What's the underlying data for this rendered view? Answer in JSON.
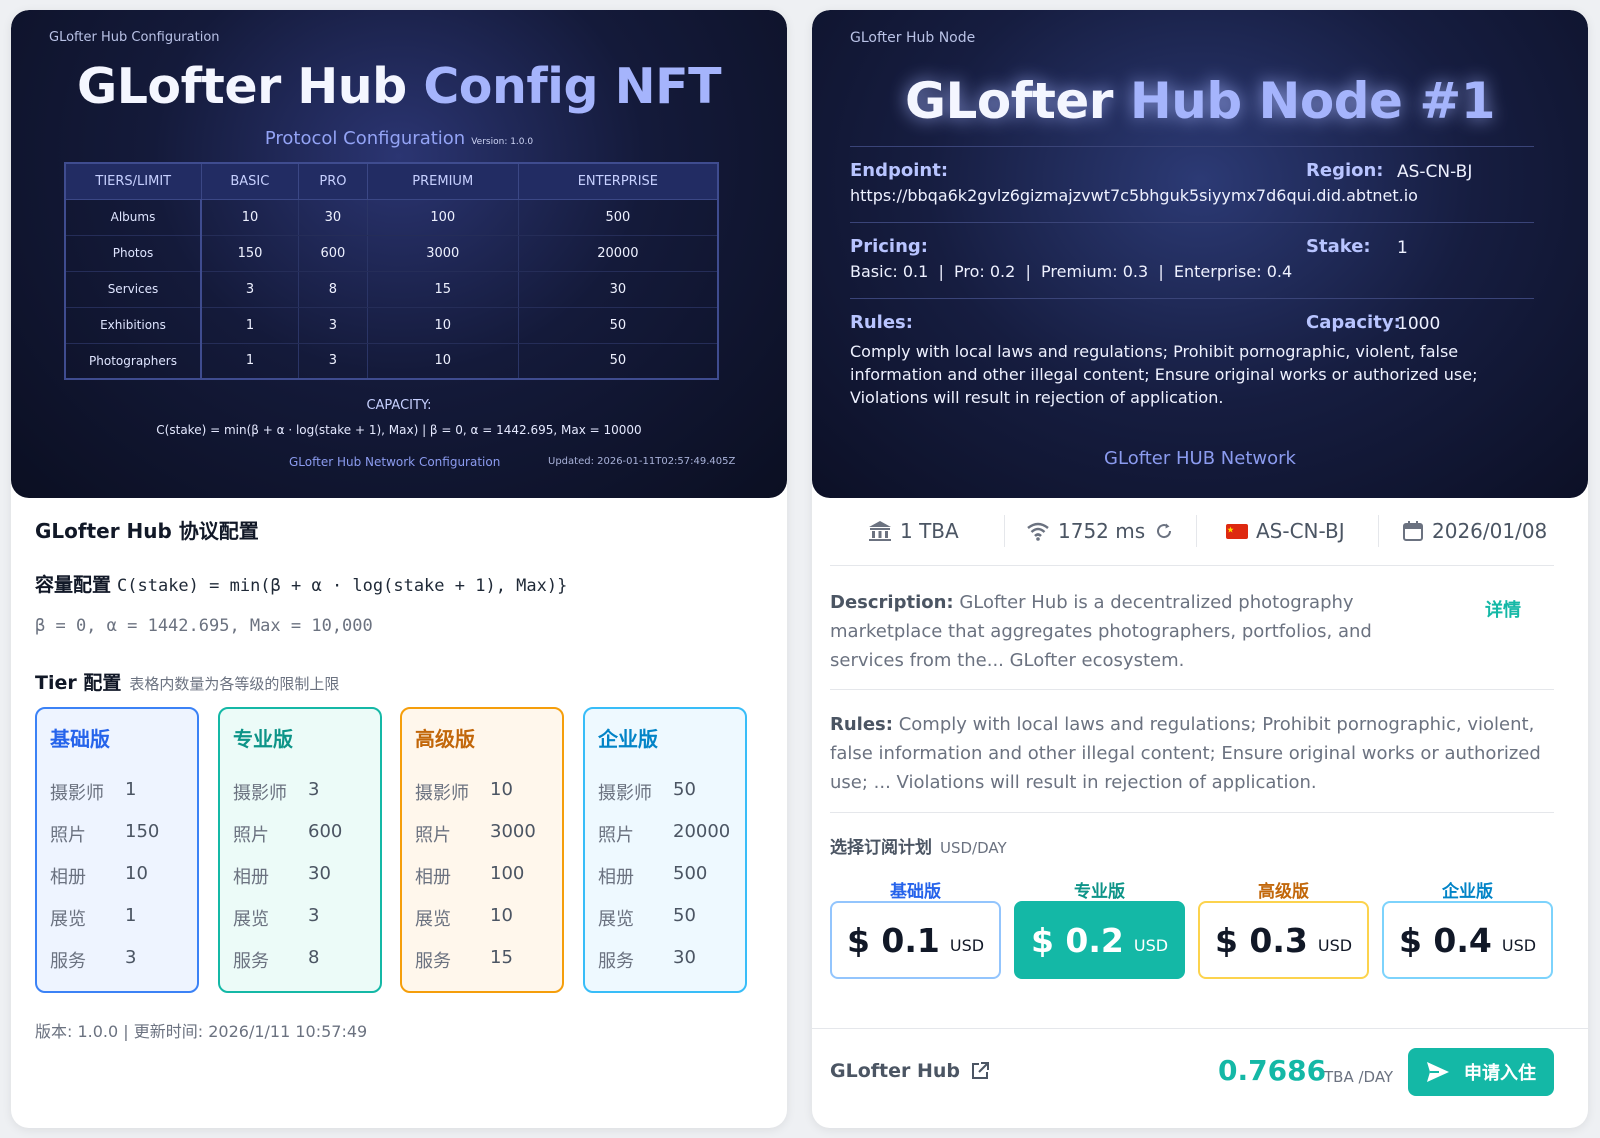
{
  "left": {
    "nft": {
      "small_label": "GLofter Hub Configuration",
      "title_part1": "GLofter Hub",
      "title_part2": "Config NFT",
      "subtitle": "Protocol Configuration",
      "version_label": "Version: 1.0.0",
      "table": {
        "headers": [
          "TIERS/LIMIT",
          "BASIC",
          "PRO",
          "PREMIUM",
          "ENTERPRISE"
        ],
        "rows": [
          [
            "Albums",
            "10",
            "30",
            "100",
            "500"
          ],
          [
            "Photos",
            "150",
            "600",
            "3000",
            "20000"
          ],
          [
            "Services",
            "3",
            "8",
            "15",
            "30"
          ],
          [
            "Exhibitions",
            "1",
            "3",
            "10",
            "50"
          ],
          [
            "Photographers",
            "1",
            "3",
            "10",
            "50"
          ]
        ]
      },
      "capacity_label": "CAPACITY:",
      "capacity_formula": "C(stake) = min(β + α · log(stake + 1), Max) | β = 0, α = 1442.695, Max = 10000",
      "footer_left": "GLofter Hub Network Configuration",
      "footer_right": "Updated: 2026-01-11T02:57:49.405Z"
    },
    "heading": "GLofter Hub 协议配置",
    "capacity_title": "容量配置",
    "capacity_formula": "C(stake) = min(β + α · log(stake + 1), Max)}",
    "capacity_params": "β = 0, α = 1442.695, Max = 10,000",
    "tier_title": "Tier 配置",
    "tier_note": "表格内数量为各等级的限制上限",
    "tiers": [
      {
        "name": "基础版",
        "rows": [
          [
            "摄影师",
            "1"
          ],
          [
            "照片",
            "150"
          ],
          [
            "相册",
            "10"
          ],
          [
            "展览",
            "1"
          ],
          [
            "服务",
            "3"
          ]
        ]
      },
      {
        "name": "专业版",
        "rows": [
          [
            "摄影师",
            "3"
          ],
          [
            "照片",
            "600"
          ],
          [
            "相册",
            "30"
          ],
          [
            "展览",
            "3"
          ],
          [
            "服务",
            "8"
          ]
        ]
      },
      {
        "name": "高级版",
        "rows": [
          [
            "摄影师",
            "10"
          ],
          [
            "照片",
            "3000"
          ],
          [
            "相册",
            "100"
          ],
          [
            "展览",
            "10"
          ],
          [
            "服务",
            "15"
          ]
        ]
      },
      {
        "name": "企业版",
        "rows": [
          [
            "摄影师",
            "50"
          ],
          [
            "照片",
            "20000"
          ],
          [
            "相册",
            "500"
          ],
          [
            "展览",
            "50"
          ],
          [
            "服务",
            "30"
          ]
        ]
      }
    ],
    "footer": "版本: 1.0.0 | 更新时间: 2026/1/11 10:57:49"
  },
  "right": {
    "node": {
      "small_label": "GLofter Hub Node",
      "title_part1": "GLofter",
      "title_part2": "Hub Node #1",
      "endpoint_label": "Endpoint:",
      "endpoint_value": "https://bbqa6k2gvlz6gizmajzvwt7c5bhguk5siyymx7d6qui.did.abtnet.io",
      "region_label": "Region:",
      "region_value": "AS-CN-BJ",
      "pricing_label": "Pricing:",
      "pricing_value": "Basic: 0.1  |  Pro: 0.2  |  Premium: 0.3  |  Enterprise: 0.4",
      "stake_label": "Stake:",
      "stake_value": "1",
      "rules_label": "Rules:",
      "capacity_label": "Capacity:",
      "capacity_value": "1000",
      "rules_text": "Comply with local laws and regulations; Prohibit pornographic, violent, false information and other illegal content; Ensure original works or authorized use; Violations will result in rejection of application.",
      "footer": "GLofter HUB Network"
    },
    "stats": {
      "stake": "1 TBA",
      "latency": "1752 ms",
      "region": "AS-CN-BJ",
      "date": "2026/01/08"
    },
    "description_label": "Description:",
    "description_text": "GLofter Hub is a decentralized photography marketplace that aggregates photographers, portfolios, and services from the... GLofter ecosystem.",
    "detail_link": "详情",
    "rules_label": "Rules:",
    "rules_text": "Comply with local laws and regulations; Prohibit pornographic, violent, false information and other illegal content; Ensure original works or authorized use; ... Violations will result in rejection of application.",
    "plan_title": "选择订阅计划",
    "plan_unit": "USD/DAY",
    "plans": [
      {
        "name": "基础版",
        "amount": "$ 0.1",
        "currency": "USD"
      },
      {
        "name": "专业版",
        "amount": "$ 0.2",
        "currency": "USD"
      },
      {
        "name": "高级版",
        "amount": "$ 0.3",
        "currency": "USD"
      },
      {
        "name": "企业版",
        "amount": "$ 0.4",
        "currency": "USD"
      }
    ],
    "hub_name": "GLofter Hub",
    "price_value": "0.7686",
    "price_unit": "TBA /DAY",
    "apply_label": "申请入住",
    "colors": {
      "accent": "#14b8a6",
      "basic": "#2563eb",
      "pro": "#0d9488",
      "premium": "#c2670a",
      "enterprise": "#0284c7"
    }
  }
}
